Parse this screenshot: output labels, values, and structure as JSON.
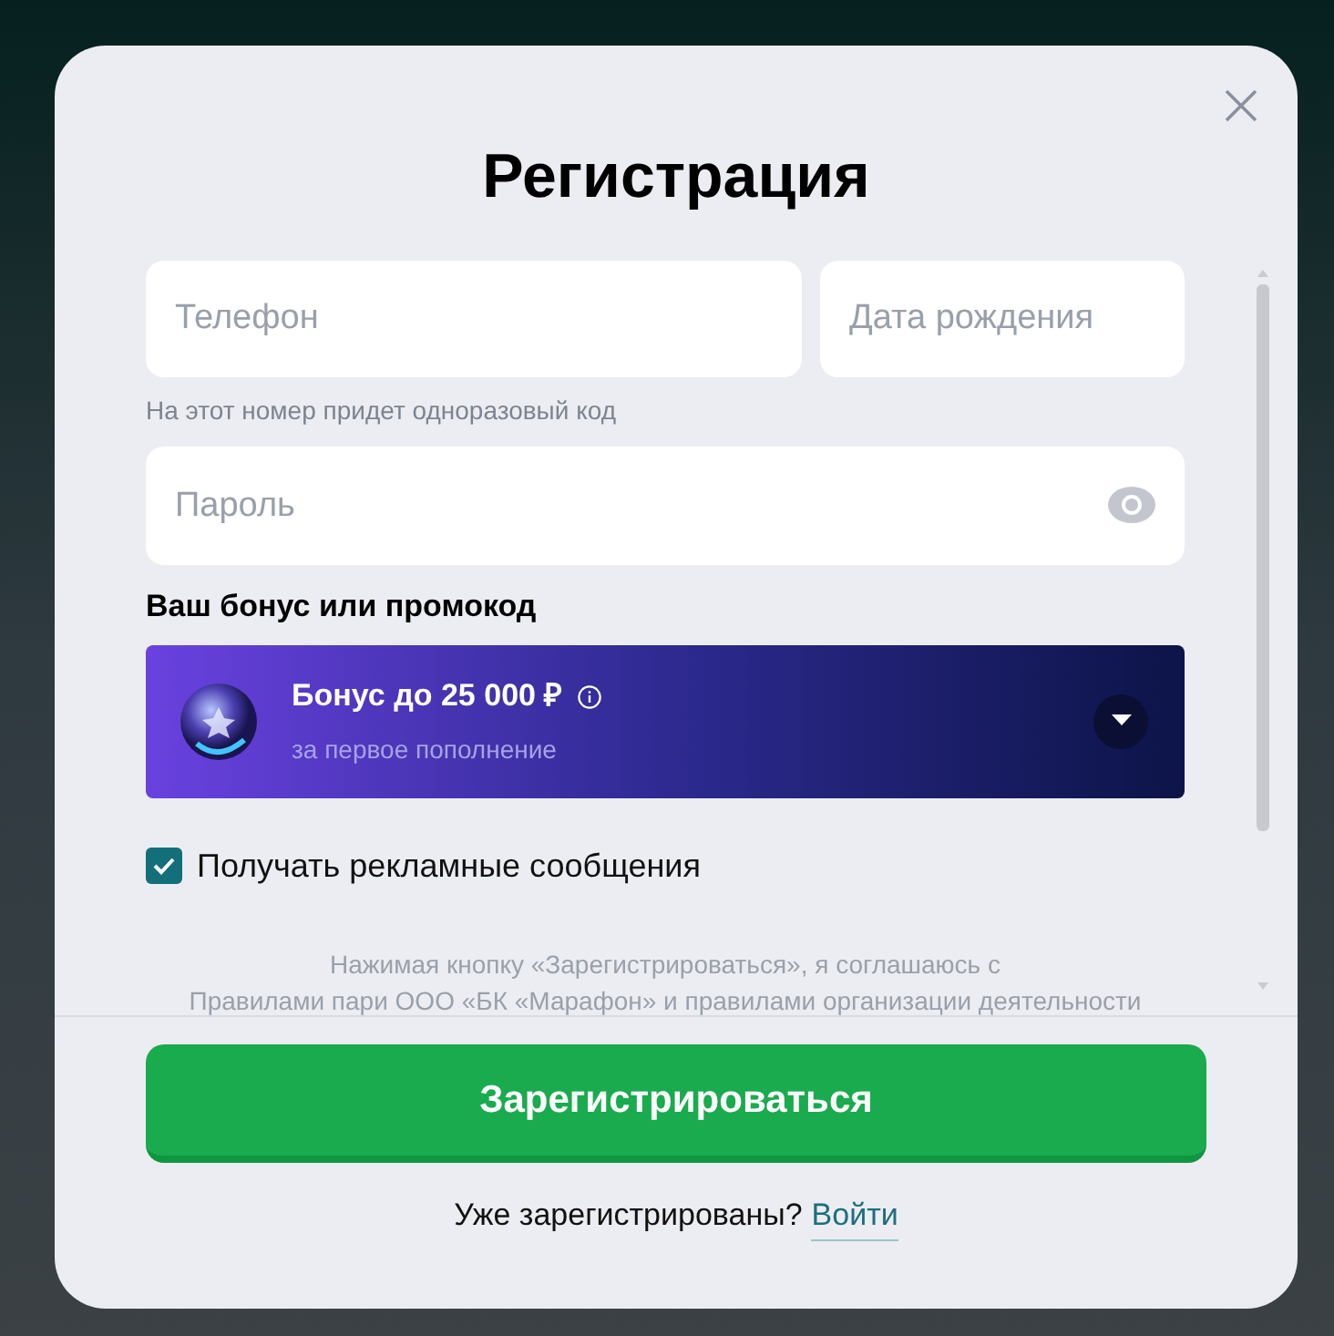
{
  "dialog": {
    "title": "Регистрация"
  },
  "fields": [
    {
      "kind": "phone",
      "placeholder": "Телефон"
    },
    {
      "kind": "date",
      "placeholder": "Дата рождения"
    }
  ],
  "phone_hint": "На этот номер придет одноразовый код",
  "password": {
    "placeholder": "Пароль"
  },
  "bonus_label": "Ваш бонус или промокод",
  "bonus": {
    "title": "Бонус до 25 000 ₽",
    "subtitle": "за первое пополнение"
  },
  "ads_checkbox": {
    "label": "Получать рекламные сообщения",
    "checked": true
  },
  "terms": [
    "Нажимая кнопку «Зарегистрироваться», я соглашаюсь с",
    "Правилами пари ООО «БК «Марафон» и правилами организации деятельности"
  ],
  "register_button": "Зарегистрироваться",
  "login_prompt": {
    "text": "Уже зарегистрированы?",
    "link": "Войти"
  }
}
